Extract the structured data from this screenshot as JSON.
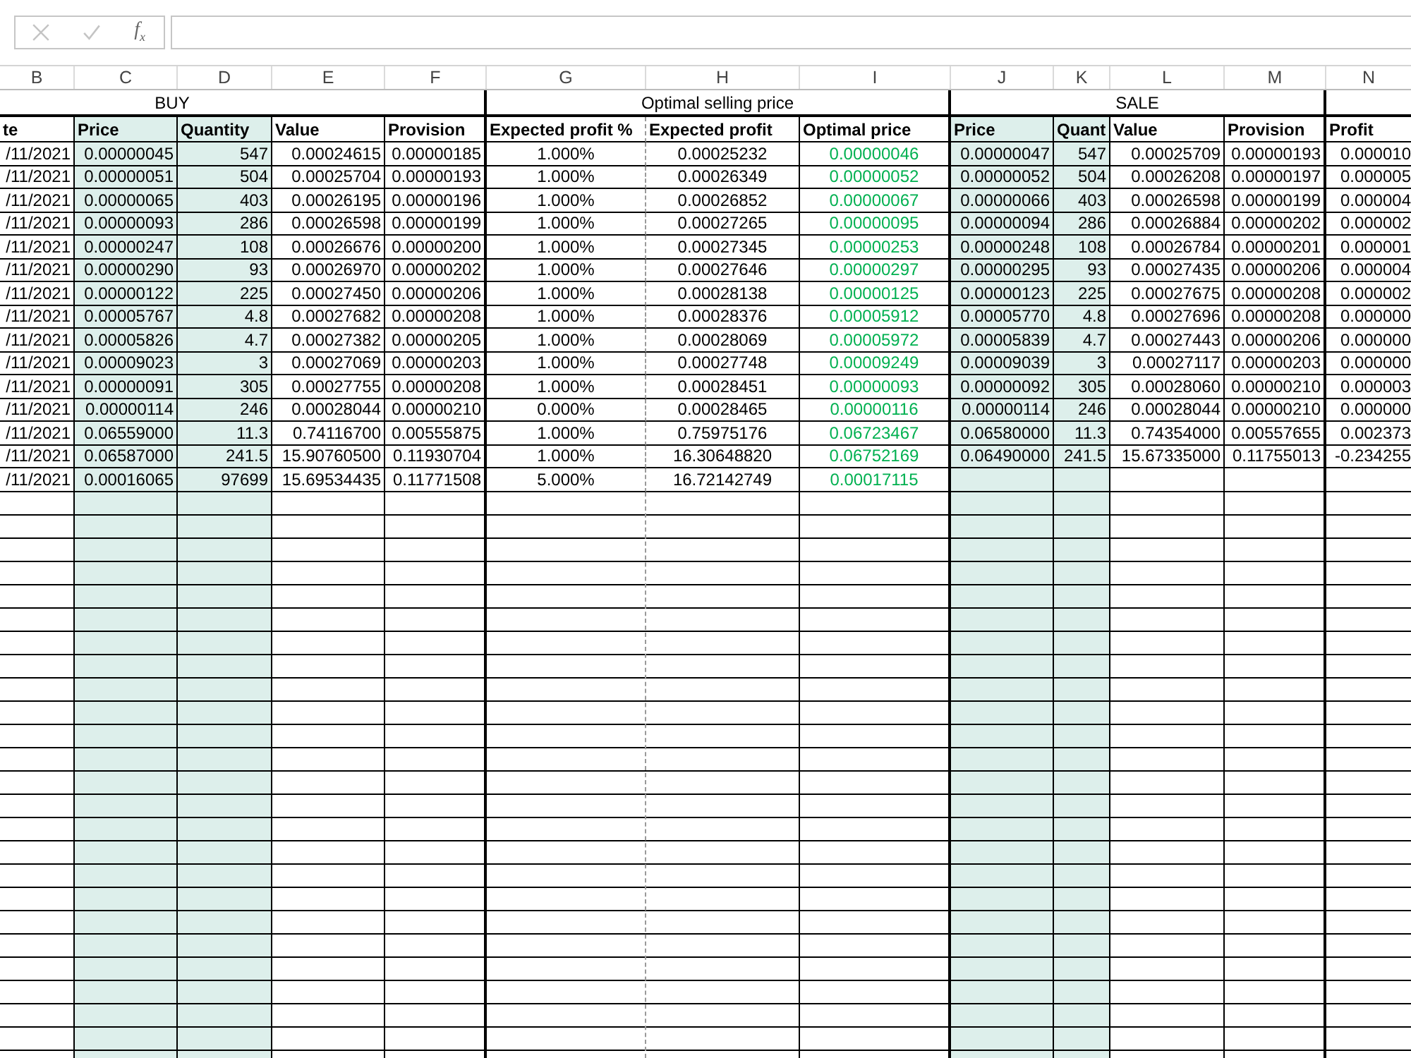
{
  "formula_bar": {
    "buttons_enabled": false,
    "function_label": "f$_{x}$"
  },
  "groups": [
    {
      "label": "BUY",
      "columns": [
        {
          "letter": "B",
          "title": "te",
          "highlighted": false
        },
        {
          "letter": "C",
          "title": "Price",
          "highlighted": true
        },
        {
          "letter": "D",
          "title": "Quantity",
          "highlighted": true
        },
        {
          "letter": "E",
          "title": "Value",
          "highlighted": false
        },
        {
          "letter": "F",
          "title": "Provision",
          "highlighted": false
        }
      ]
    },
    {
      "label": "Optimal selling price",
      "columns": [
        {
          "letter": "G",
          "title": "Expected profit %",
          "highlighted": false
        },
        {
          "letter": "H",
          "title": "Expected profit",
          "highlighted": false
        },
        {
          "letter": "I",
          "title": "Optimal price",
          "highlighted": false,
          "color": "#00b050"
        }
      ]
    },
    {
      "label": "SALE",
      "columns": [
        {
          "letter": "J",
          "title": "Price",
          "highlighted": true
        },
        {
          "letter": "K",
          "title": "Quant",
          "highlighted": true
        },
        {
          "letter": "L",
          "title": "Value",
          "highlighted": false
        },
        {
          "letter": "M",
          "title": "Provision",
          "highlighted": false
        }
      ]
    },
    {
      "columns": [
        {
          "letter": "N",
          "title": "Profit",
          "highlighted": false
        }
      ]
    }
  ],
  "rows": [
    [
      "/11/2021",
      "0.00000045",
      "547",
      "0.00024615",
      "0.00000185",
      "1.000%",
      "0.00025232",
      "0.00000046",
      "0.00000047",
      "547",
      "0.00025709",
      "0.00000193",
      "0.000010"
    ],
    [
      "/11/2021",
      "0.00000051",
      "504",
      "0.00025704",
      "0.00000193",
      "1.000%",
      "0.00026349",
      "0.00000052",
      "0.00000052",
      "504",
      "0.00026208",
      "0.00000197",
      "0.000005"
    ],
    [
      "/11/2021",
      "0.00000065",
      "403",
      "0.00026195",
      "0.00000196",
      "1.000%",
      "0.00026852",
      "0.00000067",
      "0.00000066",
      "403",
      "0.00026598",
      "0.00000199",
      "0.000004"
    ],
    [
      "/11/2021",
      "0.00000093",
      "286",
      "0.00026598",
      "0.00000199",
      "1.000%",
      "0.00027265",
      "0.00000095",
      "0.00000094",
      "286",
      "0.00026884",
      "0.00000202",
      "0.000002"
    ],
    [
      "/11/2021",
      "0.00000247",
      "108",
      "0.00026676",
      "0.00000200",
      "1.000%",
      "0.00027345",
      "0.00000253",
      "0.00000248",
      "108",
      "0.00026784",
      "0.00000201",
      "0.000001"
    ],
    [
      "/11/2021",
      "0.00000290",
      "93",
      "0.00026970",
      "0.00000202",
      "1.000%",
      "0.00027646",
      "0.00000297",
      "0.00000295",
      "93",
      "0.00027435",
      "0.00000206",
      "0.000004"
    ],
    [
      "/11/2021",
      "0.00000122",
      "225",
      "0.00027450",
      "0.00000206",
      "1.000%",
      "0.00028138",
      "0.00000125",
      "0.00000123",
      "225",
      "0.00027675",
      "0.00000208",
      "0.000002"
    ],
    [
      "/11/2021",
      "0.00005767",
      "4.8",
      "0.00027682",
      "0.00000208",
      "1.000%",
      "0.00028376",
      "0.00005912",
      "0.00005770",
      "4.8",
      "0.00027696",
      "0.00000208",
      "0.000000"
    ],
    [
      "/11/2021",
      "0.00005826",
      "4.7",
      "0.00027382",
      "0.00000205",
      "1.000%",
      "0.00028069",
      "0.00005972",
      "0.00005839",
      "4.7",
      "0.00027443",
      "0.00000206",
      "0.000000"
    ],
    [
      "/11/2021",
      "0.00009023",
      "3",
      "0.00027069",
      "0.00000203",
      "1.000%",
      "0.00027748",
      "0.00009249",
      "0.00009039",
      "3",
      "0.00027117",
      "0.00000203",
      "0.000000"
    ],
    [
      "/11/2021",
      "0.00000091",
      "305",
      "0.00027755",
      "0.00000208",
      "1.000%",
      "0.00028451",
      "0.00000093",
      "0.00000092",
      "305",
      "0.00028060",
      "0.00000210",
      "0.000003"
    ],
    [
      "/11/2021",
      "0.00000114",
      "246",
      "0.00028044",
      "0.00000210",
      "0.000%",
      "0.00028465",
      "0.00000116",
      "0.00000114",
      "246",
      "0.00028044",
      "0.00000210",
      "0.000000"
    ],
    [
      "/11/2021",
      "0.06559000",
      "11.3",
      "0.74116700",
      "0.00555875",
      "1.000%",
      "0.75975176",
      "0.06723467",
      "0.06580000",
      "11.3",
      "0.74354000",
      "0.00557655",
      "0.002373"
    ],
    [
      "/11/2021",
      "0.06587000",
      "241.5",
      "15.90760500",
      "0.11930704",
      "1.000%",
      "16.30648820",
      "0.06752169",
      "0.06490000",
      "241.5",
      "15.67335000",
      "0.11755013",
      "-0.234255"
    ],
    [
      "/11/2021",
      "0.00016065",
      "97699",
      "15.69534435",
      "0.11771508",
      "5.000%",
      "16.72142749",
      "0.00017115"
    ]
  ]
}
